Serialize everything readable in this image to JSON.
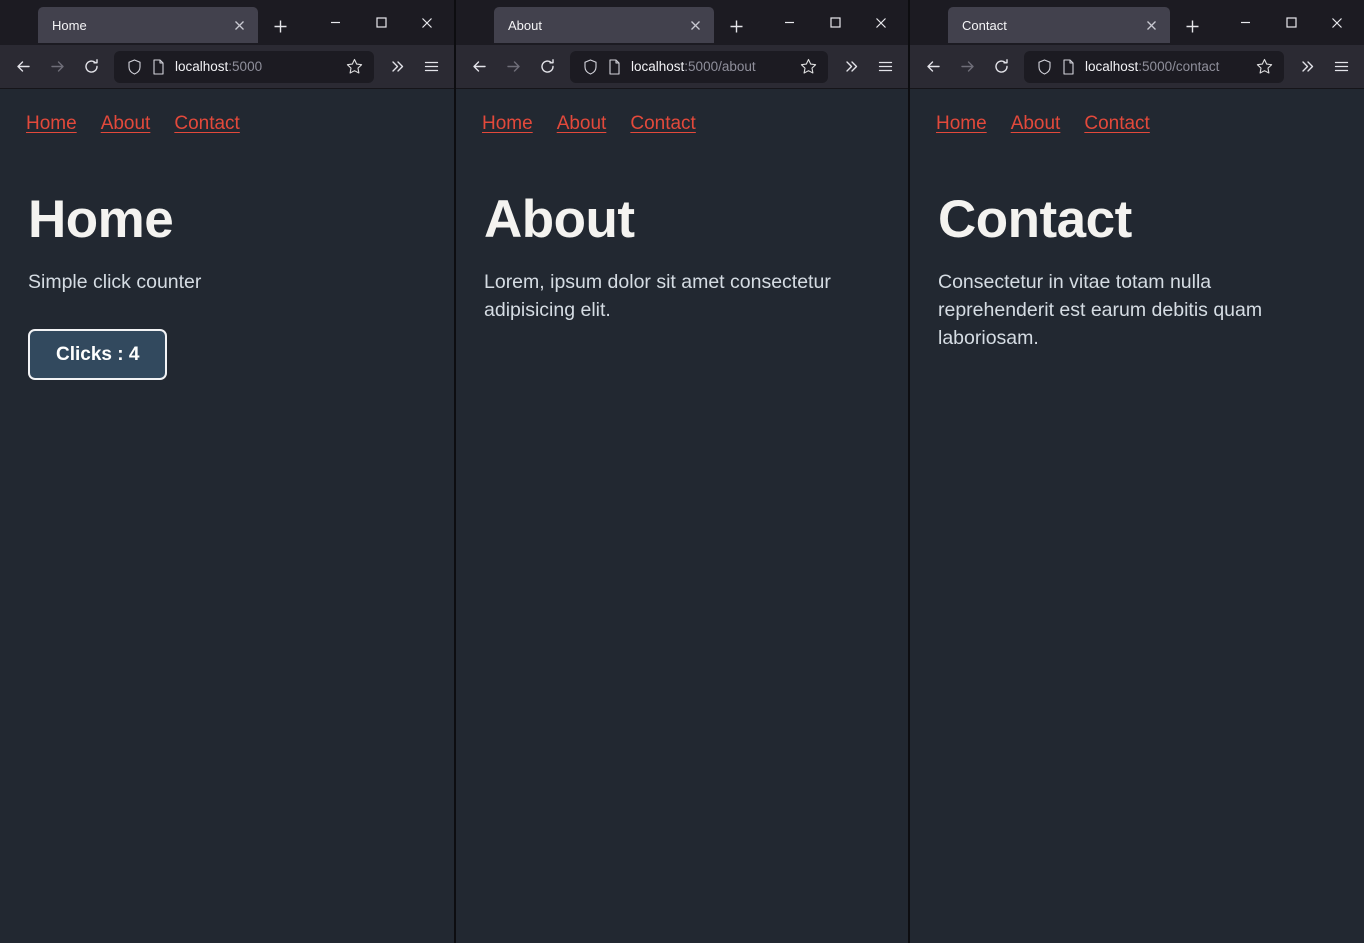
{
  "colors": {
    "page_background": "#222831",
    "link_red": "#e3493b",
    "heading_white": "#f4f3f0",
    "body_text": "#d5dce3",
    "button_fill": "#32495e",
    "button_border": "#f2f3f5",
    "chrome_tabstrip": "#1c1b22",
    "chrome_toolbar": "#2b2a33",
    "active_tab": "#42414d"
  },
  "windows": [
    {
      "tab": {
        "title": "Home",
        "close_label": "x"
      },
      "toolbar": {
        "back": "back-arrow",
        "forward": "forward-arrow",
        "reload": "reload-arrow",
        "shield": "shield-icon",
        "page_icon": "page-icon",
        "url_host": "localhost",
        "url_path": ":5000",
        "url_full": "localhost:5000",
        "bookmark": "star-icon",
        "overflow": "chevron-double-right-icon",
        "menu": "hamburger-icon"
      },
      "window_controls": {
        "minimize": "minimize-icon",
        "maximize": "maximize-icon",
        "close": "close-icon"
      },
      "newtab": "plus-icon",
      "page": {
        "nav": [
          "Home",
          "About",
          "Contact"
        ],
        "heading": "Home",
        "paragraph": "Simple click counter",
        "button": "Clicks : 4",
        "click_count": 4
      }
    },
    {
      "tab": {
        "title": "About",
        "close_label": "x"
      },
      "toolbar": {
        "back": "back-arrow",
        "forward": "forward-arrow",
        "reload": "reload-arrow",
        "shield": "shield-icon",
        "page_icon": "page-icon",
        "url_host": "localhost",
        "url_path": ":5000/about",
        "url_full": "localhost:5000/about",
        "bookmark": "star-icon",
        "overflow": "chevron-double-right-icon",
        "menu": "hamburger-icon"
      },
      "window_controls": {
        "minimize": "minimize-icon",
        "maximize": "maximize-icon",
        "close": "close-icon"
      },
      "newtab": "plus-icon",
      "page": {
        "nav": [
          "Home",
          "About",
          "Contact"
        ],
        "heading": "About",
        "paragraph": "Lorem, ipsum dolor sit amet consectetur adipisicing elit."
      }
    },
    {
      "tab": {
        "title": "Contact",
        "close_label": "x"
      },
      "toolbar": {
        "back": "back-arrow",
        "forward": "forward-arrow",
        "reload": "reload-arrow",
        "shield": "shield-icon",
        "page_icon": "page-icon",
        "url_host": "localhost",
        "url_path": ":5000/contact",
        "url_full": "localhost:5000/contact",
        "bookmark": "star-icon",
        "overflow": "chevron-double-right-icon",
        "menu": "hamburger-icon"
      },
      "window_controls": {
        "minimize": "minimize-icon",
        "maximize": "maximize-icon",
        "close": "close-icon"
      },
      "newtab": "plus-icon",
      "page": {
        "nav": [
          "Home",
          "About",
          "Contact"
        ],
        "heading": "Contact",
        "paragraph": "Consectetur in vitae totam nulla reprehenderit est earum debitis quam laboriosam."
      }
    }
  ]
}
